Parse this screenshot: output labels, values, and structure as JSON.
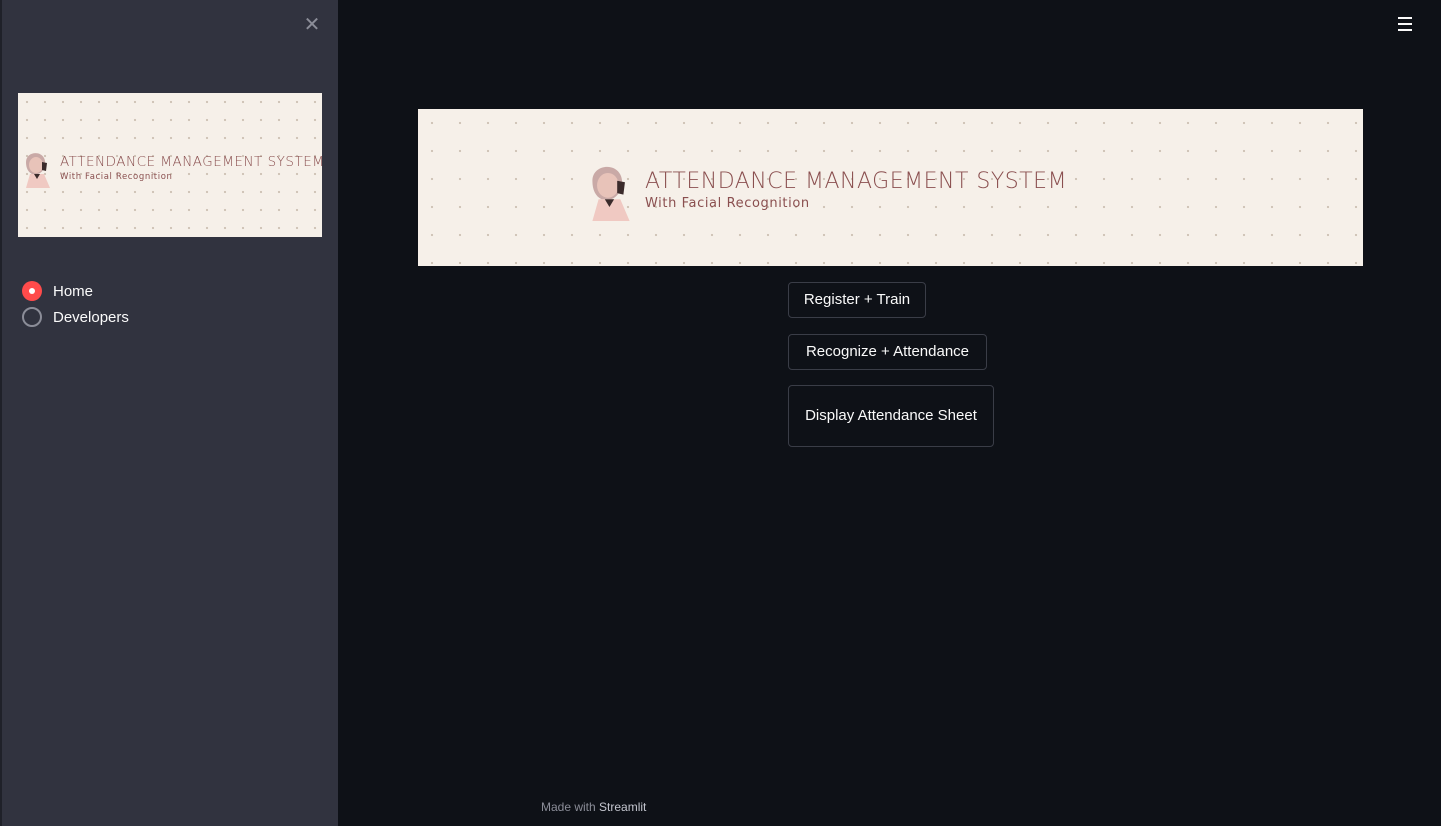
{
  "sidebar": {
    "close_icon": "close-icon",
    "banner": {
      "title": "ATTENDANCE MANAGEMENT SYSTEM",
      "subtitle": "With Facial Recognition"
    },
    "radio": {
      "options": [
        {
          "label": "Home",
          "checked": true
        },
        {
          "label": "Developers",
          "checked": false
        }
      ]
    }
  },
  "header": {
    "menu_icon": "hamburger-menu-icon"
  },
  "main": {
    "banner": {
      "title": "ATTENDANCE MANAGEMENT SYSTEM",
      "subtitle": "With Facial Recognition"
    },
    "buttons": {
      "register_train": "Register + Train",
      "recognize_attendance": "Recognize + Attendance",
      "display_sheet": "Display Attendance Sheet"
    }
  },
  "footer": {
    "prefix": "Made with",
    "brand": "Streamlit"
  },
  "colors": {
    "background": "#0e1117",
    "sidebar": "#31333f",
    "accent": "#ff4b4b",
    "banner_bg": "#f6f0e9",
    "banner_text": "#8a4f4f"
  }
}
